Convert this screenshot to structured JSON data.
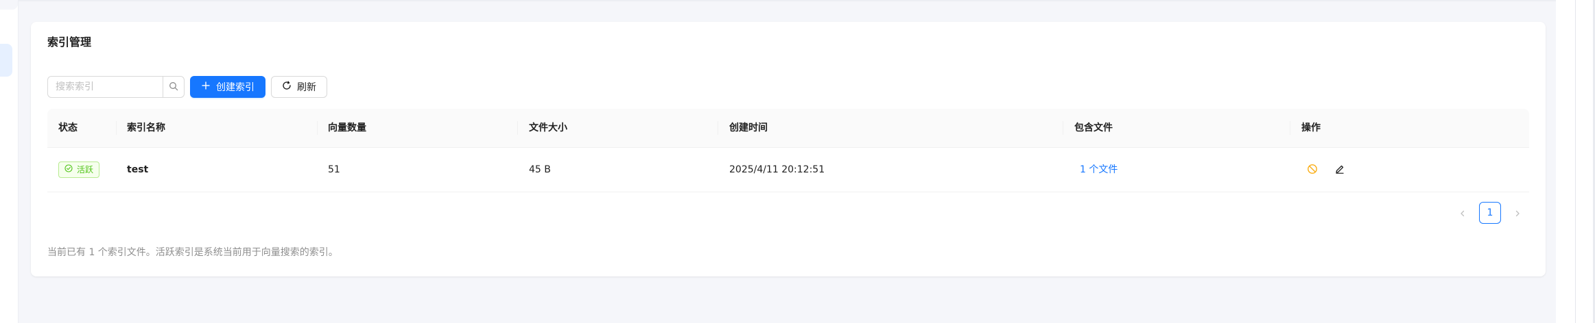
{
  "card": {
    "title": "索引管理"
  },
  "toolbar": {
    "search_placeholder": "搜索索引",
    "search_icon": "search-icon",
    "create_label": "创建索引",
    "create_icon": "plus-icon",
    "refresh_label": "刷新",
    "refresh_icon": "reload-icon"
  },
  "table": {
    "columns": [
      "状态",
      "索引名称",
      "向量数量",
      "文件大小",
      "创建时间",
      "包含文件",
      "操作"
    ],
    "rows": [
      {
        "status": "活跃",
        "name": "test",
        "vectors": "51",
        "size": "45 B",
        "created": "2025/4/11 20:12:51",
        "files": "1 个文件",
        "actions": [
          "stop-icon",
          "edit-icon"
        ]
      }
    ]
  },
  "pagination": {
    "current": "1"
  },
  "footer": {
    "note": "当前已有 1 个索引文件。活跃索引是系统当前用于向量搜索的索引。"
  },
  "colors": {
    "primary": "#1677ff",
    "success": "#52c41a",
    "warning": "#faad14"
  }
}
